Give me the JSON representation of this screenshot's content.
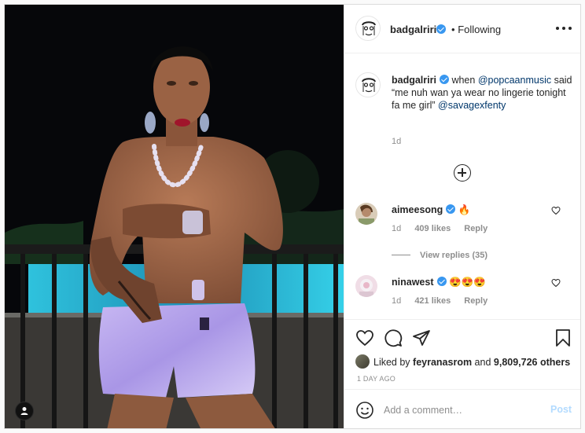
{
  "photo": {
    "alt_icon": "user-tag-icon"
  },
  "header": {
    "username": "badgalriri",
    "separator": "•",
    "follow_status": "Following",
    "more_icon": "more-options-icon"
  },
  "caption": {
    "username": "badgalriri",
    "text_1": " when ",
    "mention_1": "@popcaanmusic",
    "text_2": " said “me nuh wan ya wear no lingerie tonight fa me girl” ",
    "mention_2": "@savagexfenty",
    "time": "1d"
  },
  "comments": [
    {
      "username": "aimeesong",
      "emoji": "🔥",
      "time": "1d",
      "likes": "409 likes",
      "reply": "Reply",
      "view_replies": "View replies (35)"
    },
    {
      "username": "ninawest",
      "emoji": "😍😍😍",
      "time": "1d",
      "likes": "421 likes",
      "reply": "Reply"
    }
  ],
  "actions": {
    "liked_by_prefix": "Liked by ",
    "liked_by_user": "feyranasrom",
    "liked_by_and": " and ",
    "liked_by_count": "9,809,726 others",
    "date": "1 DAY AGO"
  },
  "add_comment": {
    "placeholder": "Add a comment…",
    "post_label": "Post"
  },
  "colors": {
    "accent": "#3897f0",
    "post_disabled": "#b3dbff",
    "mention": "#00376b",
    "muted": "#8e8e8e"
  }
}
